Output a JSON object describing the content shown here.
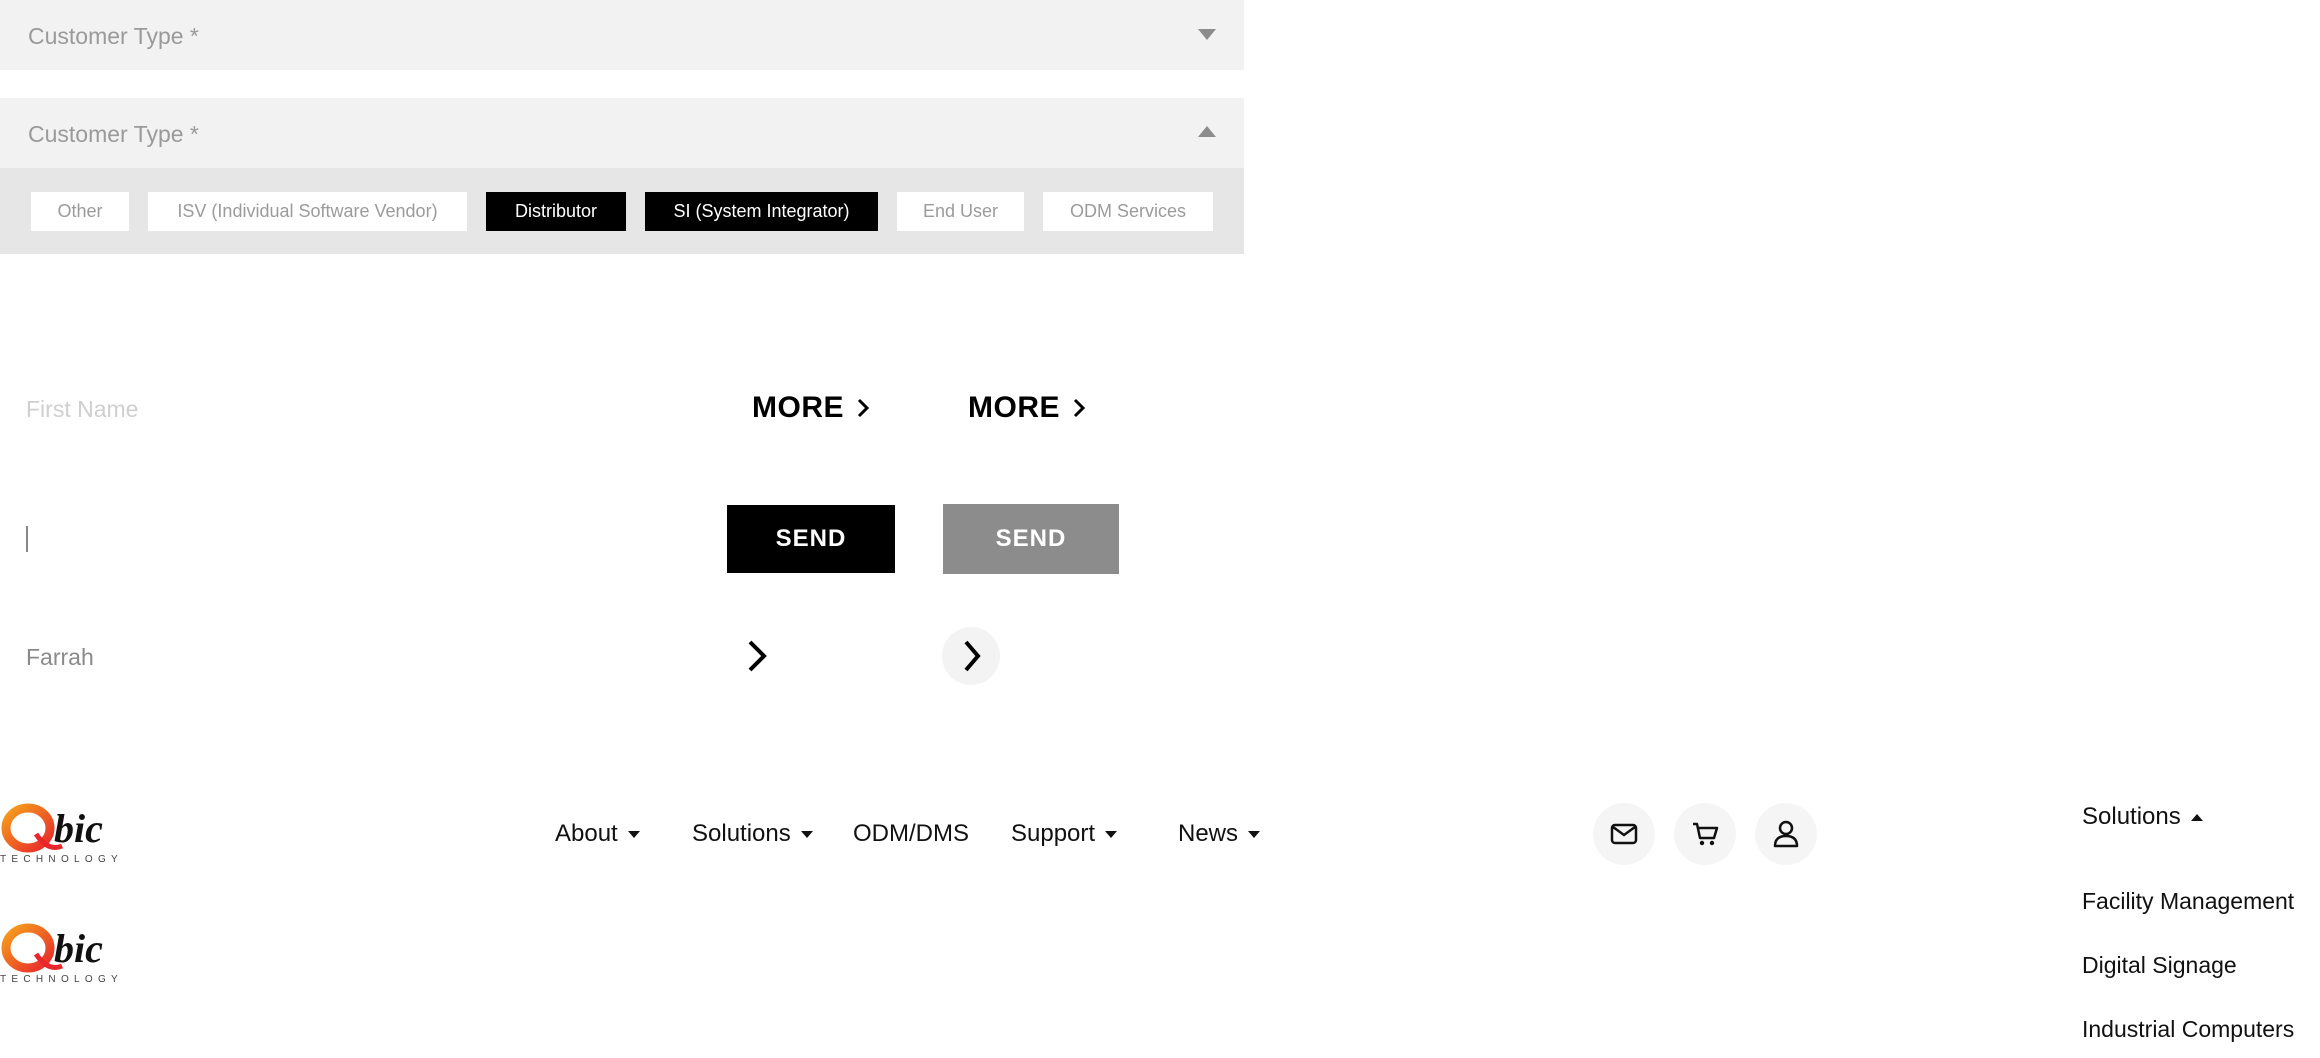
{
  "customer_type": {
    "label": "Customer Type *",
    "options": [
      "Other",
      "ISV (Individual Software Vendor)",
      "Distributor",
      "SI (System Integrator)",
      "End User",
      "ODM Services"
    ],
    "selected": [
      "Distributor",
      "SI (System Integrator)"
    ]
  },
  "form": {
    "first_name_placeholder": "First Name",
    "filled_value": "Farrah"
  },
  "buttons": {
    "more_label": "MORE",
    "send_label": "SEND",
    "send_primary_color": "#000000",
    "send_disabled_color": "#8c8c8c"
  },
  "logo": {
    "wordmark": "bic",
    "subtitle": "TECHNOLOGY",
    "brand_colors": [
      "#e8262b",
      "#f6a21b"
    ]
  },
  "nav": {
    "items": [
      "About",
      "Solutions",
      "ODM/DMS",
      "Support",
      "News"
    ],
    "icons": [
      "mail-icon",
      "cart-icon",
      "user-icon"
    ]
  },
  "solutions_menu": {
    "label": "Solutions",
    "items": [
      "Facility Management",
      "Digital Signage",
      "Industrial Computers"
    ]
  }
}
